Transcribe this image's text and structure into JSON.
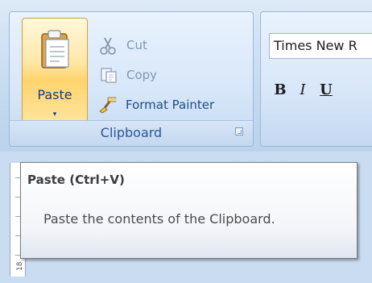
{
  "ribbon": {
    "clipboard_group": {
      "paste_label": "Paste",
      "paste_dropdown": "▾",
      "cut_label": "Cut",
      "copy_label": "Copy",
      "format_painter_label": "Format Painter",
      "group_title": "Clipboard",
      "paste_icon": "clipboard-paste-icon",
      "cut_icon": "scissors-icon",
      "copy_icon": "copy-icon",
      "format_painter_icon": "format-painter-brush-icon",
      "dialog_launcher_icon": "dialog-launcher-icon"
    },
    "font_group": {
      "font_name": "Times New R",
      "bold_label": "B",
      "italic_label": "I",
      "underline_label": "U"
    }
  },
  "tooltip": {
    "title": "Paste (Ctrl+V)",
    "description": "Paste the contents of the Clipboard."
  },
  "ruler": {
    "visible_number": "18"
  },
  "colors": {
    "ribbon_blue": "#c7dbf1",
    "paste_highlight": "#ffd36d",
    "label_blue": "#2b5797",
    "disabled_text": "#7f97b1"
  }
}
